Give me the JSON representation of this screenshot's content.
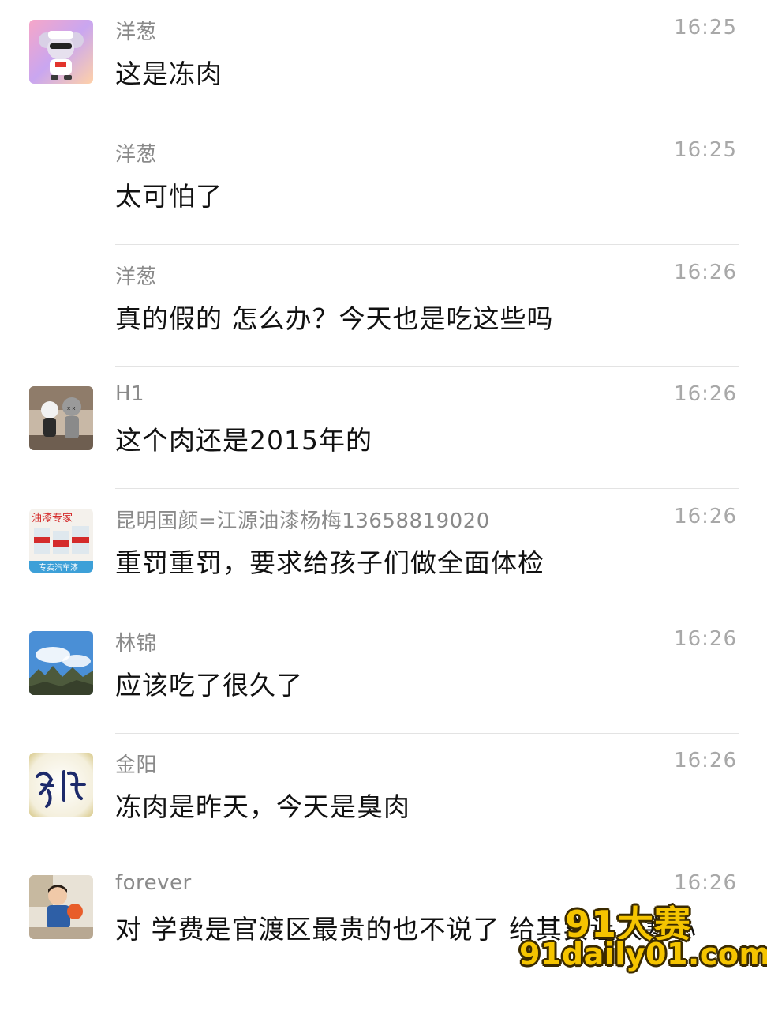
{
  "messages": [
    {
      "sender": "洋葱",
      "time": "16:25",
      "text": "这是冻肉",
      "avatar": "cartoon-mouse-avatar"
    },
    {
      "sender": "洋葱",
      "time": "16:25",
      "text": "太可怕了",
      "avatar": ""
    },
    {
      "sender": "洋葱",
      "time": "16:26",
      "text": "真的假的  怎么办？今天也是吃这些吗",
      "avatar": ""
    },
    {
      "sender": "H1",
      "time": "16:26",
      "text": "这个肉还是2015年的",
      "avatar": "kaws-figure-avatar"
    },
    {
      "sender": "昆明国颜=江源油漆杨梅13658819020",
      "time": "16:26",
      "text": "重罚重罚，要求给孩子们做全面体检",
      "avatar": "paint-cans-avatar"
    },
    {
      "sender": "林锦",
      "time": "16:26",
      "text": "应该吃了很久了",
      "avatar": "landscape-sky-avatar"
    },
    {
      "sender": "金阳",
      "time": "16:26",
      "text": "冻肉是昨天，今天是臭肉",
      "avatar": "calligraphy-avatar"
    },
    {
      "sender": "forever",
      "time": "16:26",
      "text": "对  学费是官渡区最贵的也不说了  给其实让人寒心",
      "avatar": "child-photo-avatar"
    }
  ],
  "avatar_texts": {
    "paint_cans_caption_top": "油漆专家",
    "paint_cans_caption_bottom": "专卖汽车漆"
  },
  "watermark": {
    "line1": "91大赛",
    "line2": "91daily01.com"
  }
}
